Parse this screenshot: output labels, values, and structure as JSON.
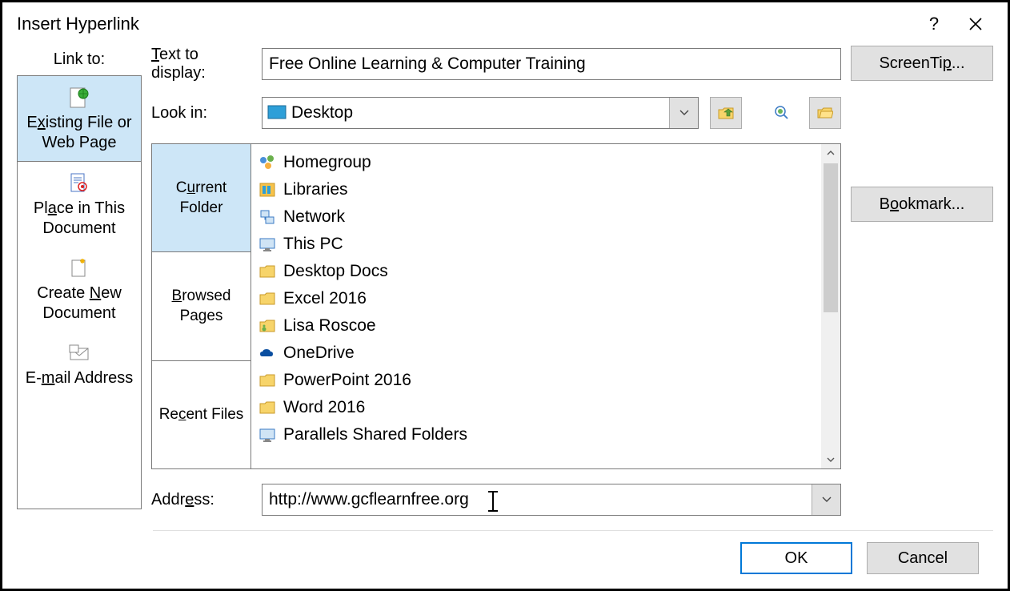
{
  "title": "Insert Hyperlink",
  "labels": {
    "link_to": "Link to:",
    "text_to_display": "Text to display:",
    "look_in": "Look in:",
    "address_pre": "Addr",
    "address_u": "e",
    "address_post": "ss:"
  },
  "text_display_value": "Free Online Learning & Computer Training",
  "look_in_value": "Desktop",
  "address_value": "http://www.gcflearnfree.org",
  "linkto_items": [
    {
      "pre": "E",
      "u": "x",
      "post": "isting File or Web Page",
      "icon": "globe-page-icon"
    },
    {
      "pre": "Pl",
      "u": "a",
      "post": "ce in This Document",
      "icon": "doc-target-icon"
    },
    {
      "pre": "Create ",
      "u": "N",
      "post": "ew Document",
      "icon": "new-doc-icon"
    },
    {
      "pre": "E-",
      "u": "m",
      "post": "ail Address",
      "icon": "email-icon"
    }
  ],
  "browse_tabs": [
    {
      "l1_pre": "C",
      "l1_u": "u",
      "l1_post": "rrent",
      "l2": "Folder"
    },
    {
      "l1_pre": "",
      "l1_u": "B",
      "l1_post": "rowsed",
      "l2": "Pages"
    },
    {
      "l1_pre": "Re",
      "l1_u": "c",
      "l1_post": "ent Files",
      "l2": ""
    }
  ],
  "files": [
    {
      "name": "Homegroup",
      "icon": "homegroup-icon"
    },
    {
      "name": "Libraries",
      "icon": "libraries-icon"
    },
    {
      "name": "Network",
      "icon": "network-icon"
    },
    {
      "name": "This PC",
      "icon": "thispc-icon"
    },
    {
      "name": "Desktop Docs",
      "icon": "folder-icon"
    },
    {
      "name": "Excel 2016",
      "icon": "folder-icon"
    },
    {
      "name": "Lisa Roscoe",
      "icon": "user-folder-icon"
    },
    {
      "name": "OneDrive",
      "icon": "onedrive-icon"
    },
    {
      "name": "PowerPoint 2016",
      "icon": "folder-icon"
    },
    {
      "name": "Word 2016",
      "icon": "folder-icon"
    },
    {
      "name": "Parallels Shared Folders",
      "icon": "thispc-icon"
    }
  ],
  "buttons": {
    "screentip_pre": "ScreenTi",
    "screentip_u": "p",
    "screentip_post": "...",
    "bookmark_pre": "B",
    "bookmark_u": "o",
    "bookmark_post": "okmark...",
    "ok": "OK",
    "cancel": "Cancel"
  }
}
